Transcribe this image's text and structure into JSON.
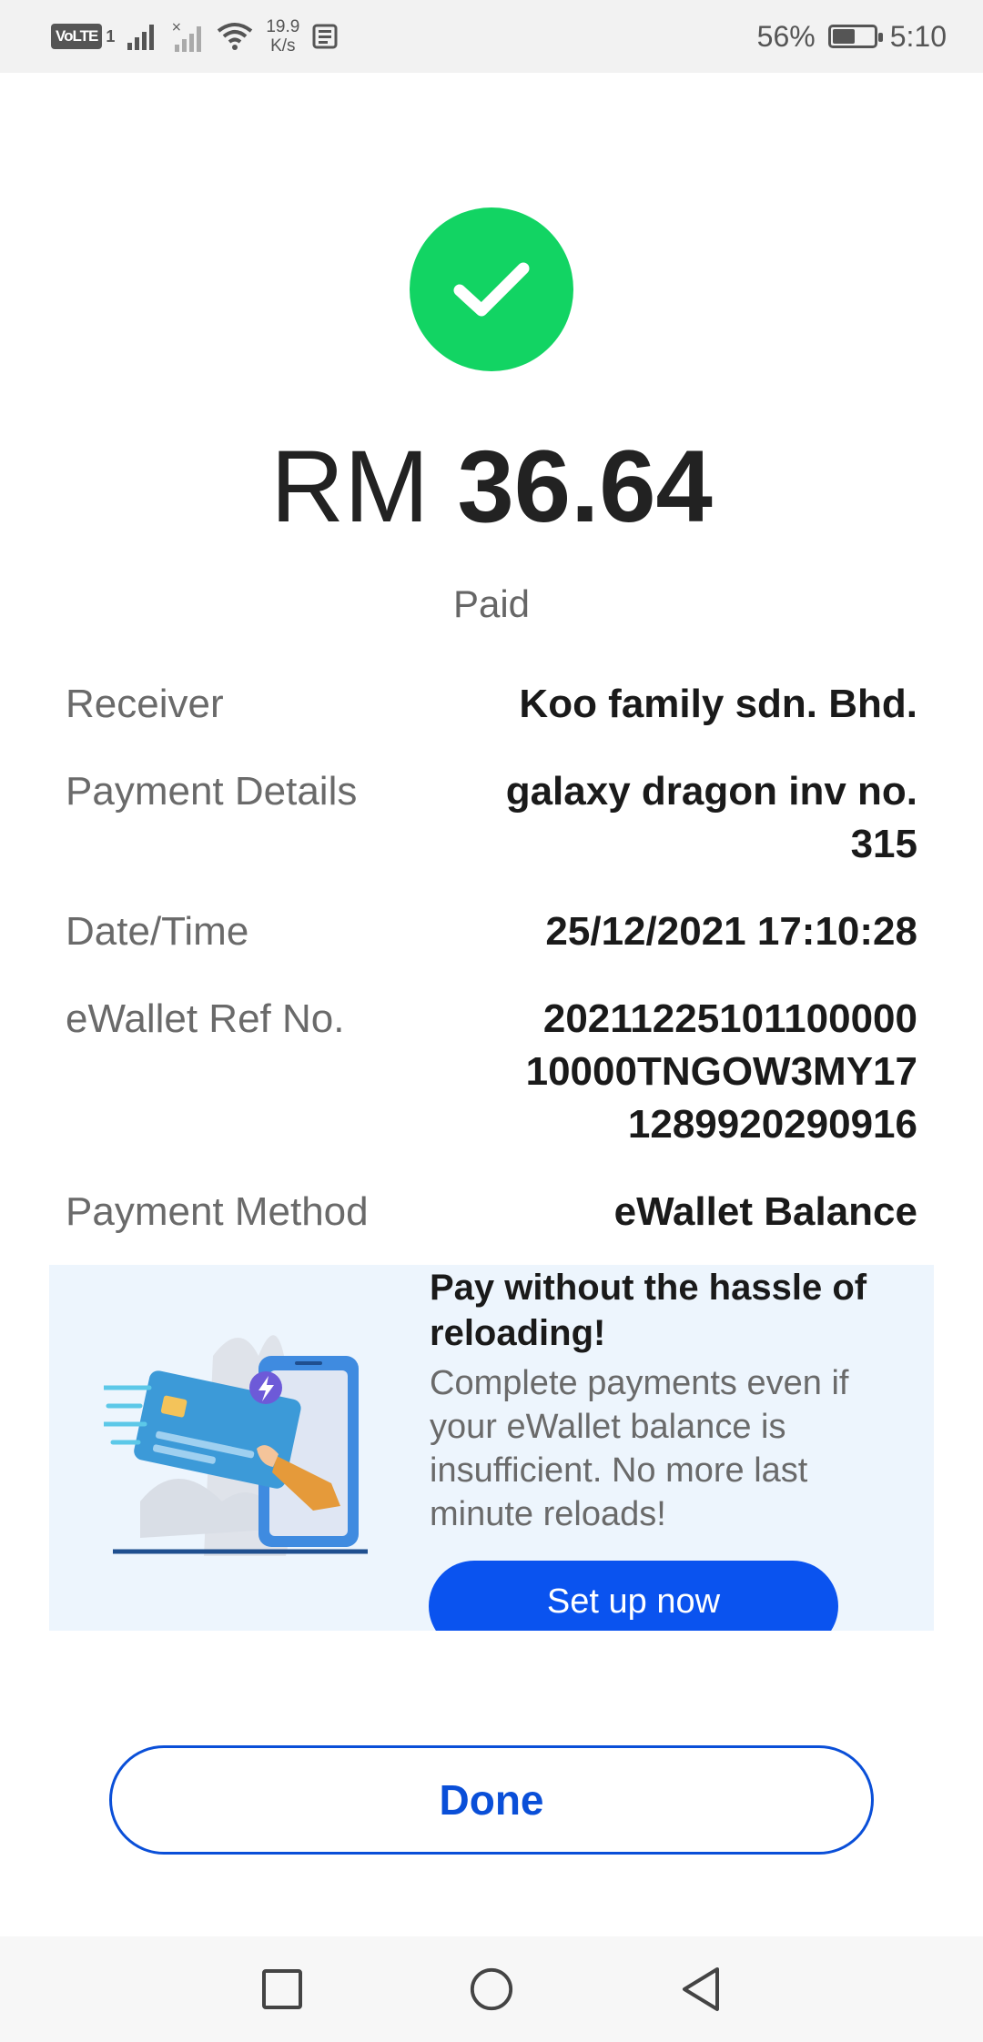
{
  "status_bar": {
    "volte": "VoLTE",
    "sim": "1",
    "speed_value": "19.9",
    "speed_unit": "K/s",
    "battery": "56%",
    "battery_level": 0.56,
    "time": "5:10"
  },
  "payment": {
    "currency": "RM",
    "amount": "36.64",
    "status": "Paid"
  },
  "details": [
    {
      "label": "Receiver",
      "value": "Koo family sdn. Bhd."
    },
    {
      "label": "Payment Details",
      "value": "galaxy dragon inv no. 315"
    },
    {
      "label": "Date/Time",
      "value": "25/12/2021 17:10:28"
    },
    {
      "label": "eWallet Ref No.",
      "value": "20211225101100000 10000TNGOW3MY17 1289920290916"
    },
    {
      "label": "Payment Method",
      "value": "eWallet Balance"
    }
  ],
  "promo": {
    "title": "Pay without the hassle of reloading!",
    "description": "Complete payments even if your eWallet balance is insufficient. No more last minute reloads!",
    "button_label": "Set up now"
  },
  "actions": {
    "done_label": "Done"
  },
  "colors": {
    "success": "#12d463",
    "primary": "#0a53ef",
    "promo_bg": "#edf5fd"
  }
}
